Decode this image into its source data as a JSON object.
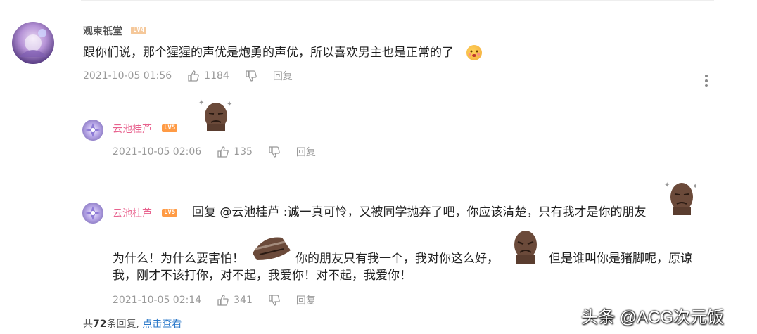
{
  "comments": [
    {
      "username": "观束祇堂",
      "level": "LV4",
      "text": "跟你们说，那个猩猩的声优是炮勇的声优，所以喜欢男主也是正常的了",
      "timestamp": "2021-10-05 01:56",
      "likes": "1184",
      "reply_label": "回复"
    },
    {
      "username": "云池桂芦",
      "level": "LV5",
      "timestamp": "2021-10-05 02:06",
      "likes": "135",
      "reply_label": "回复"
    },
    {
      "username": "云池桂芦",
      "level": "LV5",
      "text_line1": "回复 @云池桂芦 :诚一真可怜，又被同学抛弃了吧，你应该清楚，只有我才是你的朋友",
      "text_line2_a": "为什么！为什么要害怕！",
      "text_line2_b": "你的朋友只有我一个，我对你这么好，",
      "text_line2_c": "但是谁叫你是猪脚呢，原谅",
      "text_line3": "我，刚才不该打你，对不起，我爱你！对不起，我爱你！",
      "timestamp": "2021-10-05 02:14",
      "likes": "341",
      "reply_label": "回复"
    }
  ],
  "footer": {
    "prefix": "共",
    "count": "72",
    "suffix": "条回复,",
    "link": "点击查看"
  },
  "watermark": "头条 @ACG次元饭",
  "colors": {
    "pink_username": "#e8628e",
    "link": "#2a78c9",
    "meta": "#999999"
  },
  "icons": [
    "thumbs-up-icon",
    "thumbs-down-icon",
    "more-icon",
    "emoji-icon",
    "face-sticker"
  ]
}
